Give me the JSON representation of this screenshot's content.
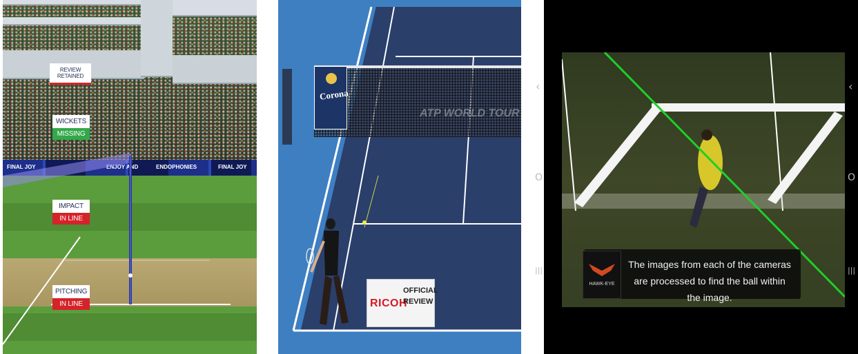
{
  "panels": {
    "cricket": {
      "review_status": "REVIEW RETAINED",
      "wickets_label": "WICKETS",
      "wickets_value": "MISSING",
      "impact_label": "IMPACT",
      "impact_value": "IN LINE",
      "pitching_label": "PITCHING",
      "pitching_value": "IN LINE",
      "colors": {
        "label_bg": "#ffffff",
        "label_text": "#24305a",
        "red": "#d5232a",
        "green": "#33a84a",
        "ball_path": "#6b5bd6"
      },
      "ad_texts": [
        "FINAL JOY",
        "ENJOY AND",
        "ENDOPHONIES",
        "FINAL JOY"
      ]
    },
    "tennis": {
      "net_sponsor": "Corona",
      "watermark": "ATP WORLD TOUR",
      "review_brand": "RICOH",
      "review_title": "OFFICIAL REVIEW",
      "colors": {
        "court": "#2b3f6b",
        "surround": "#3e7fc2",
        "ricoh_red": "#d21b25"
      }
    },
    "hawkeye": {
      "logo_text": "HAWK-EYE",
      "caption": "The images from each of the cameras are processed to find the ball within the image.",
      "colors": {
        "tracking_line": "#1ecf2b",
        "caption_bg": "#0a0a0a"
      }
    }
  },
  "controls": {
    "back_glyph": "‹",
    "home_glyph": "O",
    "recents_glyph": "|||"
  }
}
